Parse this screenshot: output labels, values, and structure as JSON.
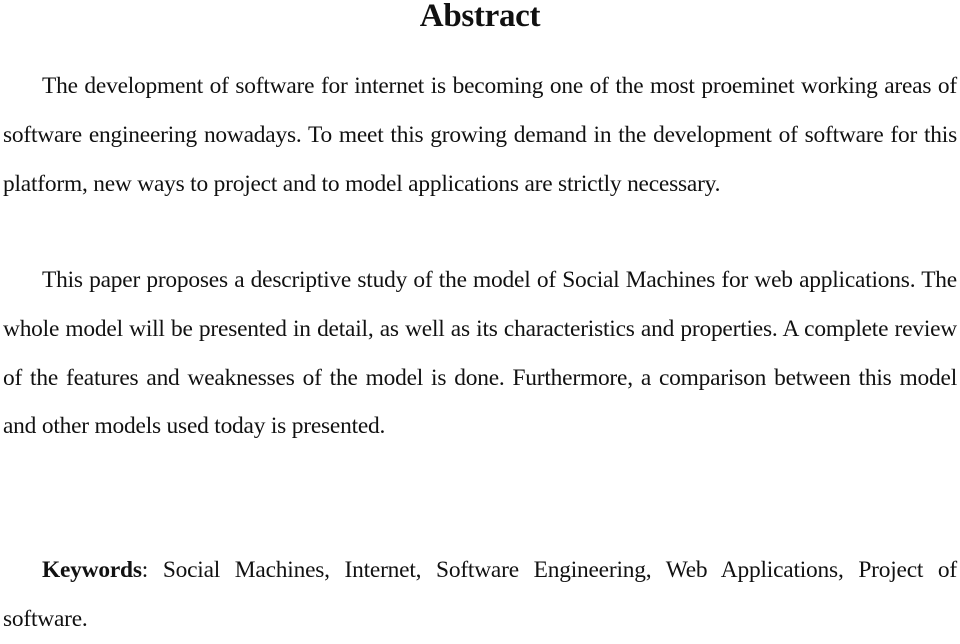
{
  "title": "Abstract",
  "paragraphs": [
    "The development of software for internet is becoming one of the most proeminet working areas of software engineering nowadays. To meet this growing demand in the development of software for this platform, new ways to project and to model applications are strictly necessary.",
    "This paper proposes a descriptive study of the model of Social Machines for web applications. The whole model will be presented in detail, as well as its characteristics and properties. A complete review of the features and weaknesses of the model is done. Furthermore, a comparison between this model and other models used today is presented."
  ],
  "keywords": {
    "label": "Keywords",
    "separator": ": ",
    "text": "Social Machines, Internet, Software Engineering, Web Applications, Project of software."
  }
}
